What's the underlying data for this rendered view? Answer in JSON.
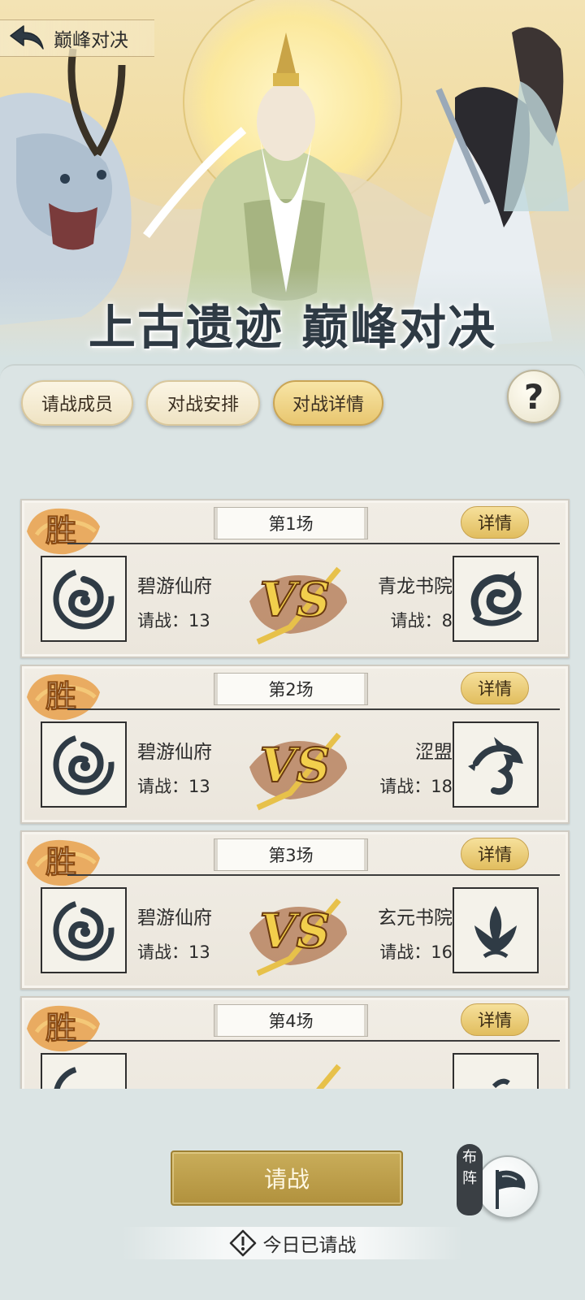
{
  "header": {
    "back_icon": "back-arrow-icon",
    "title": "巅峰对决"
  },
  "banner": {
    "title": "上古遗迹 巅峰对决"
  },
  "tabs": [
    {
      "label": "请战成员",
      "active": false
    },
    {
      "label": "对战安排",
      "active": false
    },
    {
      "label": "对战详情",
      "active": true
    }
  ],
  "help": {
    "label": "?"
  },
  "matches": [
    {
      "result": "胜",
      "round": "第1场",
      "detail_label": "详情",
      "left": {
        "name": "碧游仙府",
        "count": "请战：13",
        "emblem": "swirl-emblem-icon"
      },
      "right": {
        "name": "青龙书院",
        "count": "请战：8",
        "emblem": "coiled-dragon-emblem-icon"
      }
    },
    {
      "result": "胜",
      "round": "第2场",
      "detail_label": "详情",
      "left": {
        "name": "碧游仙府",
        "count": "请战：13",
        "emblem": "swirl-emblem-icon"
      },
      "right": {
        "name": "涩盟",
        "count": "请战：18",
        "emblem": "dragon-emblem-icon"
      }
    },
    {
      "result": "胜",
      "round": "第3场",
      "detail_label": "详情",
      "left": {
        "name": "碧游仙府",
        "count": "请战：13",
        "emblem": "swirl-emblem-icon"
      },
      "right": {
        "name": "玄元书院",
        "count": "请战：16",
        "emblem": "phoenix-emblem-icon"
      }
    },
    {
      "result": "胜",
      "round": "第4场",
      "detail_label": "详情",
      "left": {
        "name": "",
        "count": "",
        "emblem": "swirl-emblem-icon"
      },
      "right": {
        "name": "",
        "count": "",
        "emblem": "emblem-icon"
      }
    }
  ],
  "vs_label": "VS",
  "actions": {
    "challenge_label": "请战",
    "formation_label": "布阵",
    "today_status": "今日已请战"
  },
  "colors": {
    "gold": "#c9ad5a",
    "tab_active": "#e8c66f",
    "panel": "#dbe4e4",
    "win_badge": "#e8a04a"
  }
}
